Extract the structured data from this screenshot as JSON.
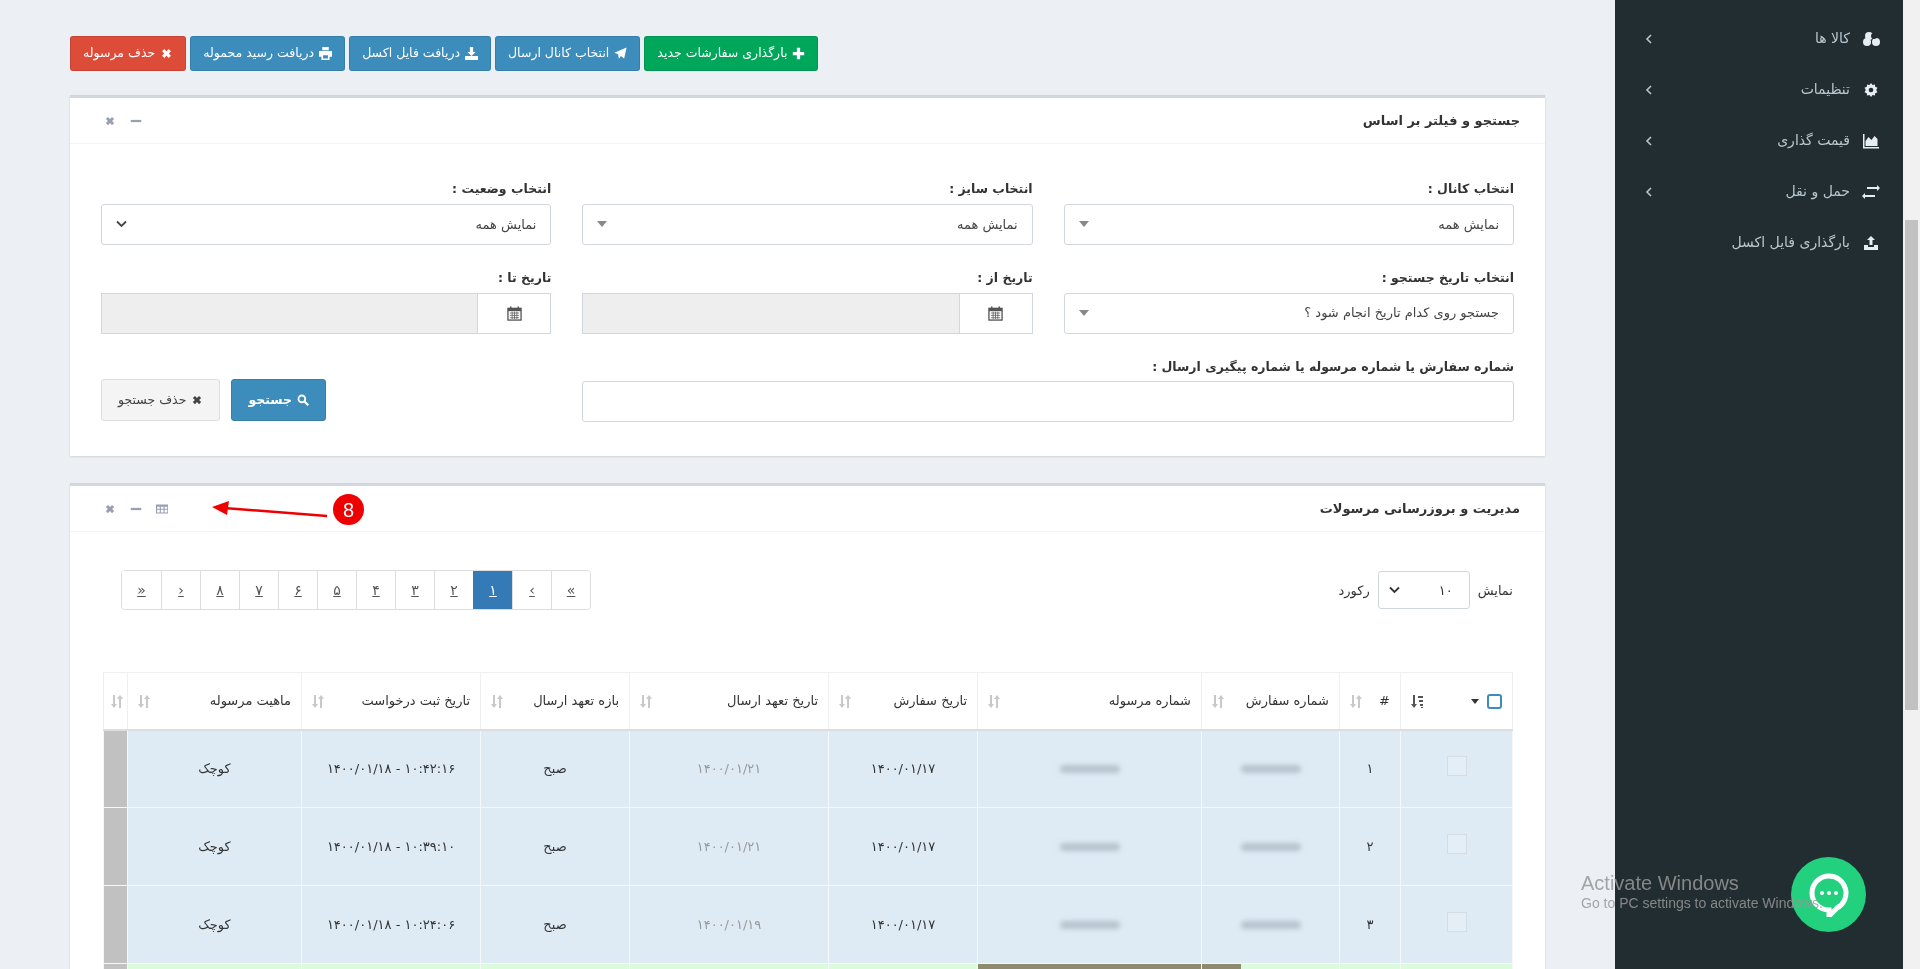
{
  "toolbar": {
    "buttons": [
      {
        "label": "بارگذاری سفارشات جدید",
        "kind": "success"
      },
      {
        "label": "انتخاب کانال ارسال",
        "kind": "primary"
      },
      {
        "label": "دریافت فایل اکسل",
        "kind": "primary"
      },
      {
        "label": "دریافت رسید محموله",
        "kind": "primary"
      },
      {
        "label": "حذف مرسوله",
        "kind": "danger"
      }
    ]
  },
  "search_panel": {
    "title": "جستجو و فیلتر بر اساس",
    "fields": [
      {
        "label": "انتخاب کانال :",
        "kind": "select",
        "value": "نمایش همه"
      },
      {
        "label": "انتخاب سایز :",
        "kind": "select",
        "value": "نمایش همه"
      },
      {
        "label": "انتخاب وضعیت :",
        "kind": "dropdown",
        "value": "نمایش همه"
      },
      {
        "label": "انتخاب تاریخ جستجو :",
        "kind": "select",
        "value": "جستجو روی کدام تاریخ انجام شود ؟"
      },
      {
        "label": "تاریخ از :",
        "kind": "date",
        "disabled": true
      },
      {
        "label": "تاریخ تا :",
        "kind": "date",
        "disabled": true
      },
      {
        "label": "شماره سفارش یا شماره مرسوله یا شماره پیگیری ارسال :",
        "kind": "text"
      }
    ],
    "buttons": [
      {
        "label": "جستجو",
        "kind": "primary"
      },
      {
        "label": "حذف جستجو",
        "kind": "default"
      }
    ]
  },
  "shipments_panel": {
    "title": "مدیریت و بروزرسانی مرسولات",
    "annotation": "8",
    "page_size": {
      "label_before": "نمایش",
      "value": "۱۰",
      "label_after": "رکورد"
    },
    "pagination": [
      {
        "label": "«",
        "selected": false
      },
      {
        "label": "‹",
        "selected": false
      },
      {
        "label": "۱",
        "selected": true
      },
      {
        "label": "۲",
        "selected": false
      },
      {
        "label": "۳",
        "selected": false
      },
      {
        "label": "۴",
        "selected": false
      },
      {
        "label": "۵",
        "selected": false
      },
      {
        "label": "۶",
        "selected": false
      },
      {
        "label": "۷",
        "selected": false
      },
      {
        "label": "۸",
        "selected": false
      },
      {
        "label": "›",
        "selected": false
      },
      {
        "label": "»",
        "selected": false
      }
    ],
    "select_all": {
      "checked": false
    },
    "columns": [
      "#",
      "شماره سفارش",
      "شماره مرسوله",
      "تاریخ سفارش",
      "تاریخ تعهد ارسال",
      "بازه تعهد ارسال",
      "تاریخ ثبت درخواست",
      "ماهیت مرسوله"
    ],
    "rows": [
      {
        "kind": "info",
        "checked": false,
        "number": "۱",
        "order_date": "۱۴۰۰/۰۱/۱۷",
        "commit_date": "۱۴۰۰/۰۱/۲۱",
        "commit_period": "صبح",
        "request_date": "۱۰:۴۲:۱۶ - ۱۴۰۰/۰۱/۱۸",
        "nature": "کوچک"
      },
      {
        "kind": "info",
        "checked": false,
        "number": "۲",
        "order_date": "۱۴۰۰/۰۱/۱۷",
        "commit_date": "۱۴۰۰/۰۱/۲۱",
        "commit_period": "صبح",
        "request_date": "۱۰:۳۹:۱۰ - ۱۴۰۰/۰۱/۱۸",
        "nature": "کوچک"
      },
      {
        "kind": "info",
        "checked": false,
        "number": "۳",
        "order_date": "۱۴۰۰/۰۱/۱۷",
        "commit_date": "۱۴۰۰/۰۱/۱۹",
        "commit_period": "صبح",
        "request_date": "۱۰:۲۴:۰۶ - ۱۴۰۰/۰۱/۱۸",
        "nature": "کوچک"
      },
      {
        "kind": "success"
      }
    ]
  },
  "sidebar": {
    "items": [
      {
        "label": "کالا ها",
        "expandable": true
      },
      {
        "label": "تنظیمات",
        "expandable": true
      },
      {
        "label": "قیمت گذاری",
        "expandable": true
      },
      {
        "label": "حمل و نقل",
        "expandable": true
      },
      {
        "label": "بارگذاری فایل اکسل",
        "expandable": false
      }
    ]
  },
  "os_notice": {
    "title": "Activate Windows",
    "text": "Go to PC settings to activate Windows."
  }
}
